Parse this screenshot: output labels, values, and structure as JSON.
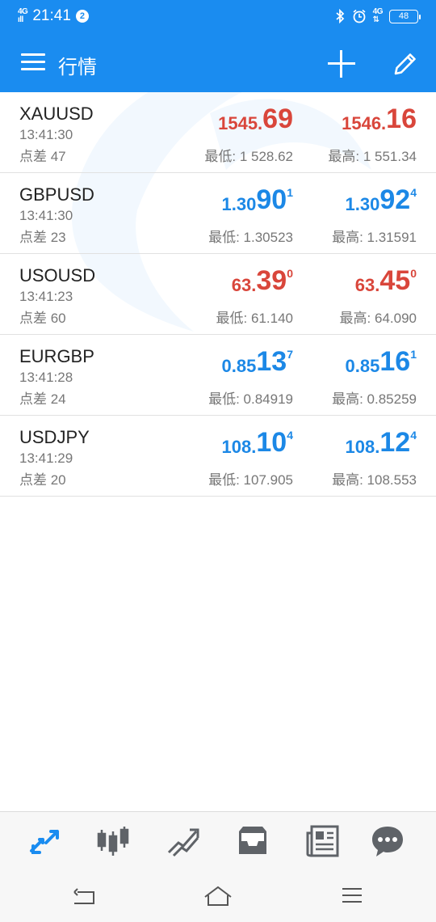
{
  "status": {
    "time": "21:41",
    "notifications": "2",
    "network_left": "4G",
    "network_right": "4G",
    "battery": "48"
  },
  "appbar": {
    "title": "行情"
  },
  "quotes": [
    {
      "symbol": "XAUUSD",
      "time": "13:41:30",
      "spread": "点差 47",
      "color": "red",
      "bid": {
        "small": "1545.",
        "big": "69",
        "sup": ""
      },
      "ask": {
        "small": "1546.",
        "big": "16",
        "sup": ""
      },
      "low": "最低: 1 528.62",
      "high": "最高: 1 551.34"
    },
    {
      "symbol": "GBPUSD",
      "time": "13:41:30",
      "spread": "点差 23",
      "color": "blue",
      "bid": {
        "small": "1.30",
        "big": "90",
        "sup": "1"
      },
      "ask": {
        "small": "1.30",
        "big": "92",
        "sup": "4"
      },
      "low": "最低: 1.30523",
      "high": "最高: 1.31591"
    },
    {
      "symbol": "USOUSD",
      "time": "13:41:23",
      "spread": "点差 60",
      "color": "red",
      "bid": {
        "small": "63.",
        "big": "39",
        "sup": "0"
      },
      "ask": {
        "small": "63.",
        "big": "45",
        "sup": "0"
      },
      "low": "最低: 61.140",
      "high": "最高: 64.090"
    },
    {
      "symbol": "EURGBP",
      "time": "13:41:28",
      "spread": "点差 24",
      "color": "blue",
      "bid": {
        "small": "0.85",
        "big": "13",
        "sup": "7"
      },
      "ask": {
        "small": "0.85",
        "big": "16",
        "sup": "1"
      },
      "low": "最低: 0.84919",
      "high": "最高: 0.85259"
    },
    {
      "symbol": "USDJPY",
      "time": "13:41:29",
      "spread": "点差 20",
      "color": "blue",
      "bid": {
        "small": "108.",
        "big": "10",
        "sup": "4"
      },
      "ask": {
        "small": "108.",
        "big": "12",
        "sup": "4"
      },
      "low": "最低: 107.905",
      "high": "最高: 108.553"
    }
  ],
  "tabs": [
    {
      "name": "quotes-icon",
      "active": true
    },
    {
      "name": "chart-icon",
      "active": false
    },
    {
      "name": "trade-icon",
      "active": false
    },
    {
      "name": "history-icon",
      "active": false
    },
    {
      "name": "news-icon",
      "active": false
    },
    {
      "name": "messages-icon",
      "active": false
    }
  ],
  "colors": {
    "primary": "#1a8cf0",
    "up": "#d9463b",
    "down": "#1c88e6",
    "icon_gray": "#5f6368"
  }
}
